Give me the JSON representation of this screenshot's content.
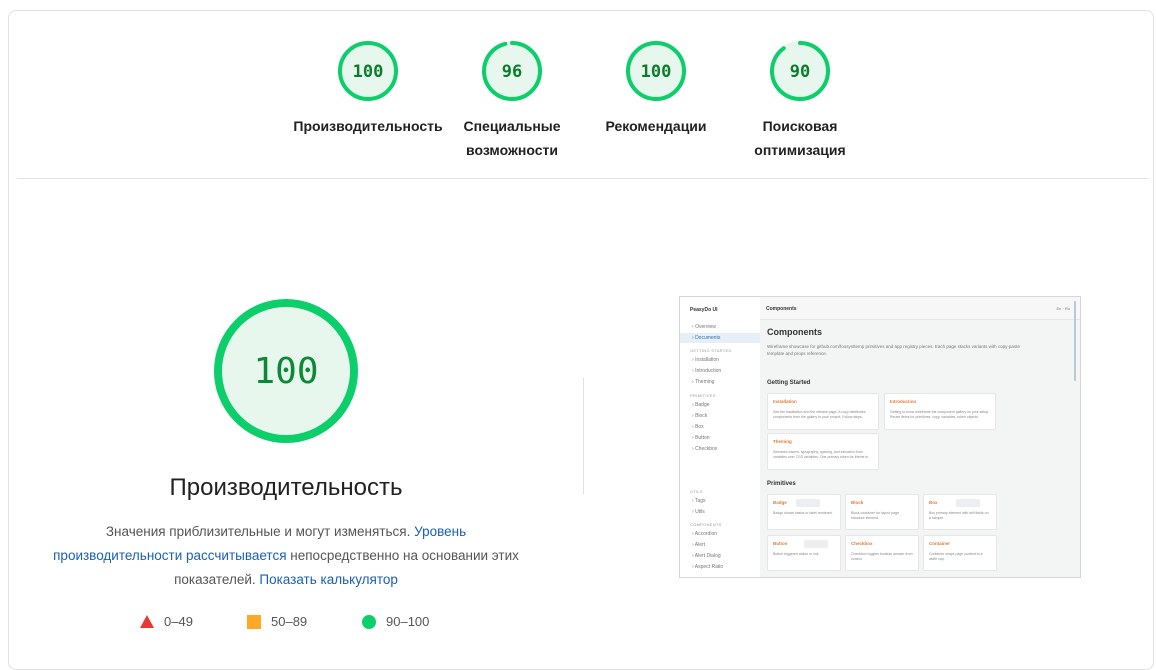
{
  "summary": [
    {
      "score": "100",
      "label": "Производительность",
      "fraction": 1.0
    },
    {
      "score": "96",
      "label": "Специальные возможности",
      "fraction": 0.96
    },
    {
      "score": "100",
      "label": "Рекомендации",
      "fraction": 1.0
    },
    {
      "score": "90",
      "label": "Поисковая оптимизация",
      "fraction": 0.9
    }
  ],
  "performance": {
    "score": "100",
    "title": "Производительность",
    "desc_part1": "Значения приблизительные и могут изменяться. ",
    "desc_link1": "Уровень производительности рассчитывается",
    "desc_part2": " непосредственно на основании этих показателей. ",
    "desc_link2": "Показать калькулятор"
  },
  "legend": [
    {
      "range": "0–49",
      "shape": "triangle",
      "color": "#e53935"
    },
    {
      "range": "50–89",
      "shape": "square",
      "color": "#ffa726"
    },
    {
      "range": "90–100",
      "shape": "circle",
      "color": "#0cce6b"
    }
  ],
  "colors": {
    "pass_stroke": "#0cce6b",
    "pass_fill": "#e8f7ee",
    "pass_text": "#0a7d2c",
    "link": "#1a5fb4"
  },
  "thumbnail": {
    "brand": "PeasyDo UI",
    "header_title": "Components",
    "header_right": "En · Ru",
    "page_title": "Components",
    "page_desc": "Wireframe showcase for github.com/foosys/temp primitives and app registry pieces. Each page stacks variants with copy-paste template and props reference.",
    "nav": [
      "Overview",
      "Documents"
    ],
    "sec_getting_started": "GETTING STARTED",
    "nav_gs": [
      "Installation",
      "Introduction",
      "Theming"
    ],
    "sec_primitives": "PRIMITIVES",
    "nav_prim": [
      "Badge",
      "Block",
      "Box",
      "Button",
      "Checkbox"
    ],
    "sec_utils": "UTILS",
    "nav_utils": [
      "Tags",
      "Utils"
    ],
    "sec_components": "COMPONENTS",
    "nav_comp": [
      "Accordion",
      "Alert",
      "Alert Dialog",
      "Aspect Ratio"
    ],
    "section1": "Getting Started",
    "cards1": [
      {
        "title": "Installation",
        "desc": "See the installation and the release page. A copy distributes components from the gallery to your project. Follow steps."
      },
      {
        "title": "Introduction",
        "desc": "Getting to know wireframe the component gallery on your setup. Reuse items for primitives, copy, variables, token objects."
      },
      {
        "title": "Theming",
        "desc": "Semantic tokens, typography, spacing, and elevation from variables over CSS variables. One primary token for theme in."
      }
    ],
    "section2": "Primitives",
    "cards2": [
      {
        "title": "Badge",
        "desc": "Badge shows status or label rendered."
      },
      {
        "title": "Block",
        "desc": "Block container for layout page structure element."
      },
      {
        "title": "Box",
        "desc": "Box primary element with sell fields on a sample."
      },
      {
        "title": "Button",
        "desc": "Button triggered action or link."
      },
      {
        "title": "Checkbox",
        "desc": "Checkbox toggles boolean answer from control."
      },
      {
        "title": "Container",
        "desc": "Container wraps page content to a width cap."
      }
    ]
  }
}
